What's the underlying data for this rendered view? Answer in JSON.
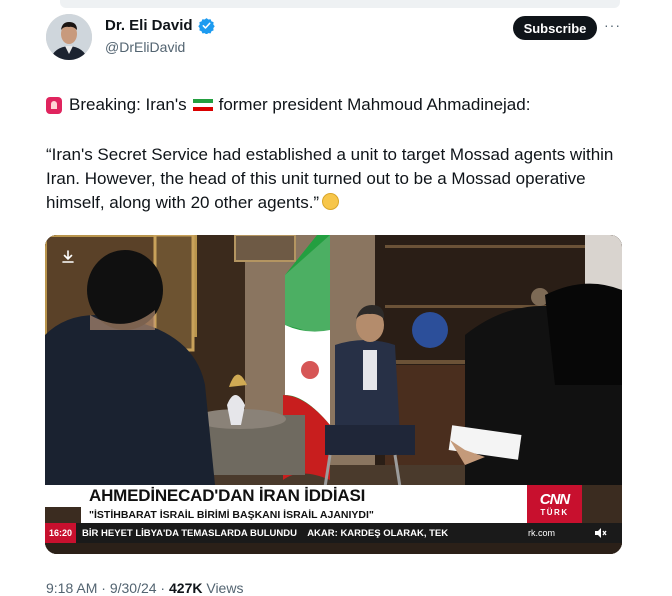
{
  "author": {
    "name": "Dr. Eli David",
    "handle": "@DrEliDavid",
    "verified_color": "#1d9bf0"
  },
  "actions": {
    "subscribe_label": "Subscribe",
    "more_label": "···"
  },
  "post": {
    "line1_prefix": "Breaking: Iran's",
    "line1_suffix": "former president Mahmoud Ahmadinejad:",
    "quote": "“Iran's Secret Service had established a unit to target Mossad agents within Iran. However, the head of this unit turned out to be a Mossad operative himself, along with 20 other agents.”"
  },
  "video": {
    "headline": "AHMEDİNECAD'DAN İRAN İDDİASI",
    "subheadline": "\"İSTİHBARAT İSRAİL BİRİMİ BAŞKANI İSRAİL AJANIYDI\"",
    "time": "16:20",
    "ticker": "BİR HEYET LİBYA'DA TEMASLARDA BULUNDU    AKAR: KARDEŞ OLARAK, TEK",
    "channel_logo": "CNN",
    "channel_sub": "TÜRK",
    "site": "rk.com"
  },
  "meta": {
    "time": "9:18 AM",
    "date": "9/30/24",
    "views_count": "427K",
    "views_label": "Views",
    "sep": " · "
  }
}
